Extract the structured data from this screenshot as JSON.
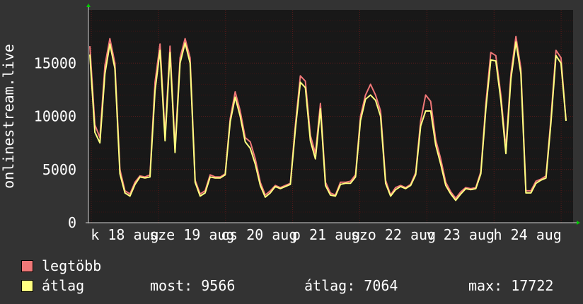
{
  "chart_data": {
    "type": "line",
    "ylabel": "onlinestream.live",
    "ylim": [
      0,
      20000
    ],
    "yticks": [
      0,
      5000,
      10000,
      15000
    ],
    "ytick_labels": [
      "0",
      "5000",
      "10000",
      "15000"
    ],
    "xtick_labels": [
      "k 18 aug",
      "sze 19 aug",
      "cs 20 aug",
      "p 21 aug",
      "szo 22 aug",
      "v 23 aug",
      "h 24 aug"
    ],
    "grid": true,
    "background": "#181818",
    "grid_color": "#5a1a1a",
    "axis_color": "#cfcfcf",
    "series": [
      {
        "name": "legtöbb",
        "color": "#f07878",
        "values": [
          16600,
          9200,
          8000,
          14800,
          17300,
          15000,
          5000,
          3000,
          2700,
          3800,
          4400,
          4300,
          4500,
          13200,
          16800,
          8200,
          16600,
          7000,
          15500,
          17300,
          15500,
          4000,
          2700,
          3000,
          4500,
          4300,
          4300,
          4600,
          9800,
          12300,
          10500,
          8000,
          7600,
          6000,
          3800,
          2600,
          3000,
          3500,
          3300,
          3500,
          3700,
          9200,
          13800,
          13300,
          8200,
          6500,
          11200,
          3800,
          2800,
          2600,
          3800,
          3800,
          3900,
          4500,
          10000,
          12000,
          13000,
          12000,
          10500,
          4000,
          2600,
          3300,
          3500,
          3300,
          3600,
          4700,
          9600,
          12000,
          11400,
          7800,
          6000,
          3800,
          2900,
          2300,
          2900,
          3300,
          3200,
          3300,
          4800,
          11200,
          16000,
          15700,
          12000,
          7000,
          14000,
          17500,
          14500,
          3000,
          3000,
          3900,
          4100,
          4400,
          9800,
          16200,
          15500,
          9600
        ]
      },
      {
        "name": "átlag",
        "color": "#ffff80",
        "values": [
          15800,
          8500,
          7500,
          14000,
          16800,
          14500,
          4600,
          2800,
          2500,
          3600,
          4300,
          4200,
          4300,
          12400,
          16200,
          7700,
          16000,
          6600,
          15000,
          16900,
          15000,
          3800,
          2500,
          2800,
          4300,
          4200,
          4200,
          4500,
          9500,
          11800,
          10000,
          7600,
          7000,
          5500,
          3500,
          2400,
          2800,
          3400,
          3200,
          3400,
          3600,
          8800,
          13200,
          12700,
          7700,
          6000,
          10700,
          3500,
          2600,
          2500,
          3600,
          3700,
          3700,
          4300,
          9600,
          11600,
          12000,
          11500,
          10000,
          3700,
          2500,
          3100,
          3400,
          3200,
          3500,
          4500,
          9100,
          10500,
          10500,
          7300,
          5500,
          3500,
          2700,
          2100,
          2700,
          3200,
          3100,
          3200,
          4600,
          10700,
          15300,
          15200,
          11500,
          6500,
          13500,
          17000,
          14000,
          2800,
          2800,
          3700,
          4000,
          4200,
          9400,
          15700,
          15000,
          9566
        ]
      }
    ]
  },
  "legend": [
    {
      "label": "legtöbb",
      "color": "#f07878"
    },
    {
      "label": "átlag",
      "color": "#ffff80"
    }
  ],
  "stats": {
    "now": "most: 9566",
    "avg": "átlag: 7064",
    "max": "max: 17722"
  }
}
